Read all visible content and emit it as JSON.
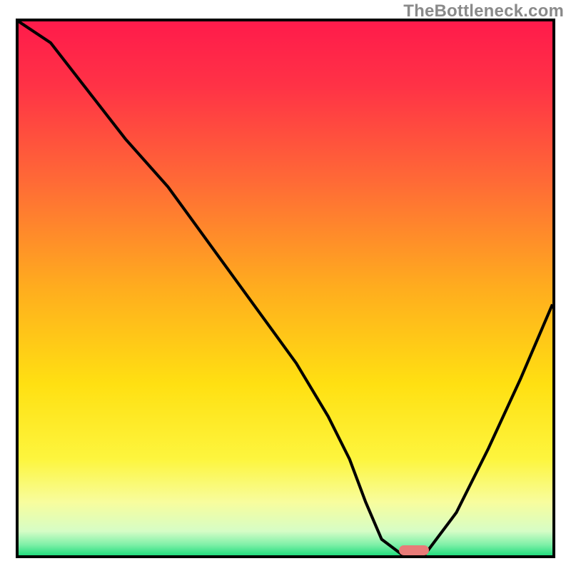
{
  "watermark": "TheBottleneck.com",
  "colors": {
    "border": "#000000",
    "line": "#000000",
    "marker": "#e87b78",
    "gradient_stops": [
      {
        "offset": 0.0,
        "color": "#ff1b4b"
      },
      {
        "offset": 0.12,
        "color": "#ff3246"
      },
      {
        "offset": 0.3,
        "color": "#ff6a36"
      },
      {
        "offset": 0.5,
        "color": "#ffad1e"
      },
      {
        "offset": 0.68,
        "color": "#ffe012"
      },
      {
        "offset": 0.82,
        "color": "#fdf53e"
      },
      {
        "offset": 0.9,
        "color": "#f8fd9d"
      },
      {
        "offset": 0.955,
        "color": "#d6fdc6"
      },
      {
        "offset": 0.98,
        "color": "#7ff0a8"
      },
      {
        "offset": 1.0,
        "color": "#23dd7e"
      }
    ]
  },
  "chart_data": {
    "type": "line",
    "title": "",
    "xlabel": "",
    "ylabel": "",
    "xlim": [
      0,
      100
    ],
    "ylim": [
      0,
      100
    ],
    "grid": false,
    "legend": false,
    "series": [
      {
        "name": "bottleneck-curve",
        "x": [
          0,
          6,
          20,
          28,
          36,
          44,
          52,
          58,
          62,
          65,
          68,
          72,
          76,
          82,
          88,
          94,
          100
        ],
        "y": [
          100,
          96,
          78,
          69,
          58,
          47,
          36,
          26,
          18,
          10,
          3,
          0,
          0,
          8,
          20,
          33,
          47
        ]
      }
    ],
    "markers": [
      {
        "name": "optimal-marker",
        "x": 74,
        "y": 1
      }
    ]
  }
}
